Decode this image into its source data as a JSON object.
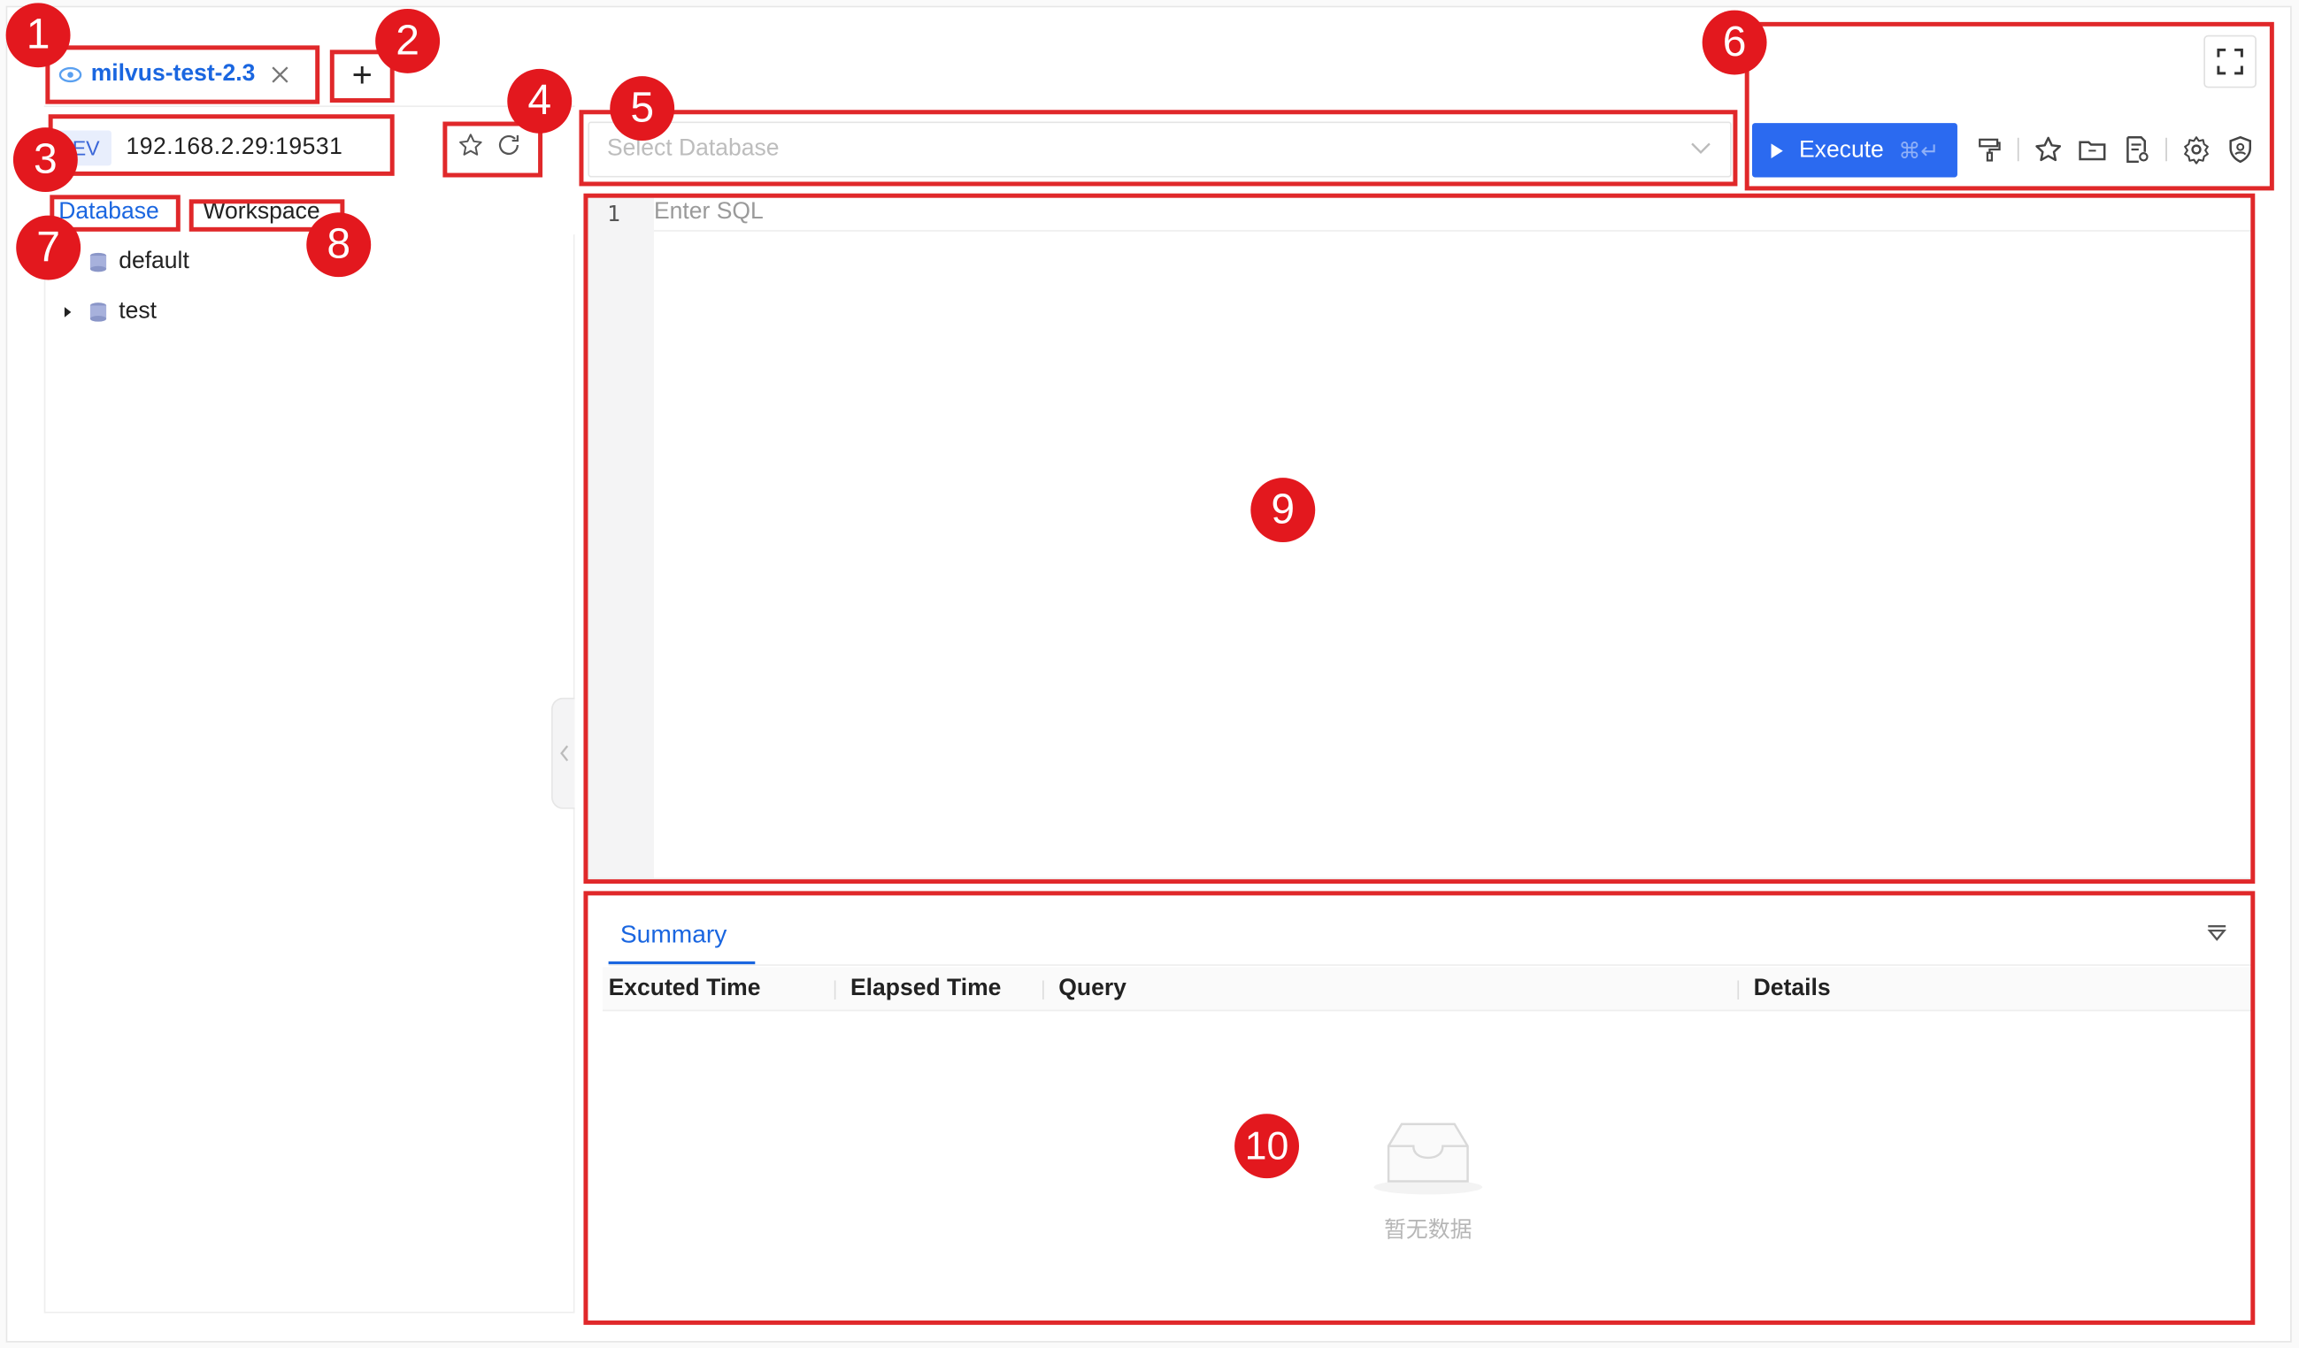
{
  "connection_tab": {
    "label": "milvus-test-2.3",
    "eye_icon": "eye-icon",
    "close_icon": "close-icon"
  },
  "add_tab": {
    "symbol": "+"
  },
  "environment": {
    "tag": "EV",
    "host": "192.168.2.29:19531"
  },
  "side_tabs": {
    "database": "Database",
    "workspace": "Workspace"
  },
  "tree": [
    {
      "name": "default"
    },
    {
      "name": "test"
    }
  ],
  "database_select": {
    "placeholder": "Select Database"
  },
  "toolbar": {
    "execute_label": "Execute",
    "execute_shortcut": "⌘↵"
  },
  "editor": {
    "line_number": "1",
    "placeholder": "Enter SQL"
  },
  "results": {
    "tab": "Summary",
    "columns": [
      "Excuted Time",
      "Elapsed Time",
      "Query",
      "Details"
    ],
    "empty_text": "暂无数据"
  },
  "annotations": [
    "1",
    "2",
    "3",
    "4",
    "5",
    "6",
    "7",
    "8",
    "9",
    "10"
  ],
  "colors": {
    "accent": "#1a66e0",
    "execute_bg": "#2b6af0",
    "annotation_red": "#e3181e"
  }
}
